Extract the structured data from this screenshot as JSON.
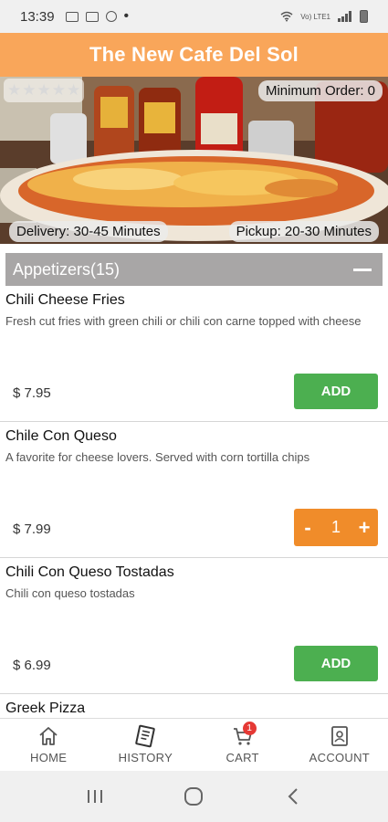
{
  "status_bar": {
    "time": "13:39",
    "network": "Vo) LTE1",
    "dot": "•"
  },
  "header": {
    "title": "The New Cafe Del Sol"
  },
  "hero": {
    "rating": {
      "filled": 0,
      "total": 5
    },
    "minimum_order": "Minimum Order: 0",
    "delivery": "Delivery: 30-45 Minutes",
    "pickup": "Pickup: 20-30 Minutes"
  },
  "category": {
    "title": "Appetizers(15)"
  },
  "menu_items": [
    {
      "name": "Chili Cheese Fries",
      "description": "Fresh cut fries with green chili or chili con carne topped with cheese",
      "price": "$ 7.95",
      "button": "ADD"
    },
    {
      "name": "Chile Con Queso",
      "description": "A favorite for cheese lovers. Served with corn tortilla chips",
      "price": "$ 7.99",
      "stepper": {
        "minus": "-",
        "quantity": "1",
        "plus": "+"
      }
    },
    {
      "name": "Chili Con Queso Tostadas",
      "description": "Chili con queso tostadas",
      "price": "$ 6.99",
      "button": "ADD"
    },
    {
      "name": "Greek Pizza"
    }
  ],
  "bottom_nav": {
    "home": "HOME",
    "history": "HISTORY",
    "cart": "CART",
    "cart_badge": "1",
    "account": "ACCOUNT"
  },
  "colors": {
    "header": "#f9a65a",
    "add_button": "#4caf50",
    "stepper": "#f08c2a",
    "category_bar": "#a8a6a6",
    "badge": "#e53935"
  },
  "icons": [
    "image-icon",
    "cast-icon",
    "timer-icon",
    "wifi-icon",
    "signal-icon",
    "battery-icon",
    "star-icon",
    "collapse-icon",
    "home-icon",
    "history-icon",
    "cart-icon",
    "account-icon",
    "recents-icon",
    "home-circle-icon",
    "back-icon"
  ]
}
